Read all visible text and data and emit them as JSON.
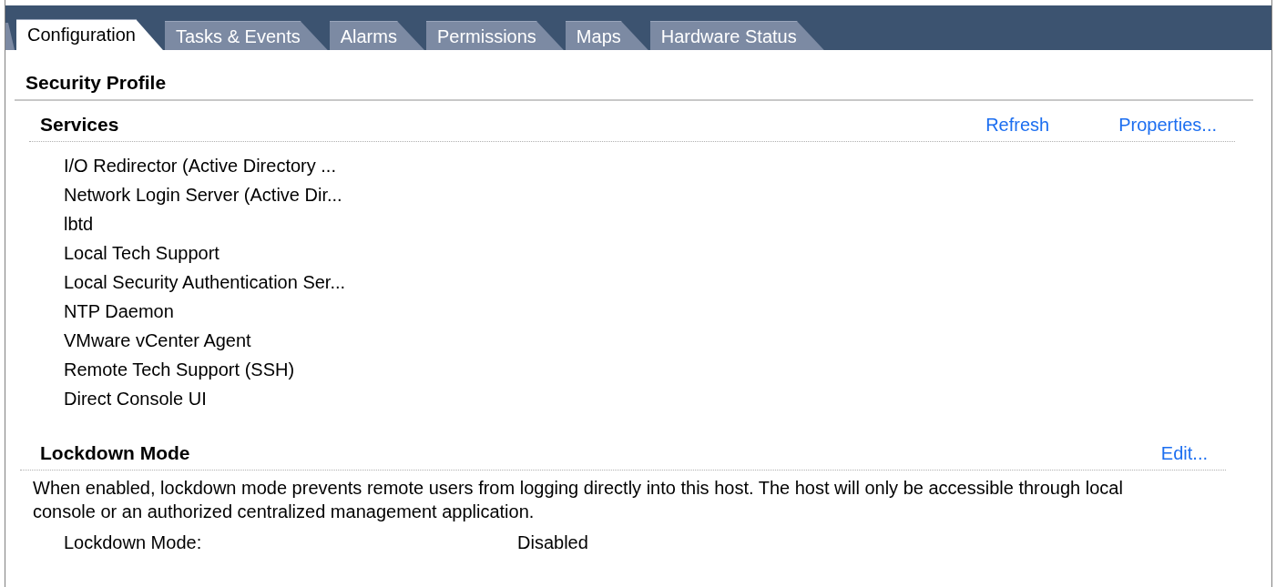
{
  "tabs": [
    {
      "label": "Configuration",
      "selected": true
    },
    {
      "label": "Tasks & Events",
      "selected": false
    },
    {
      "label": "Alarms",
      "selected": false
    },
    {
      "label": "Permissions",
      "selected": false
    },
    {
      "label": "Maps",
      "selected": false
    },
    {
      "label": "Hardware Status",
      "selected": false
    }
  ],
  "title": "Security Profile",
  "services": {
    "heading": "Services",
    "actions": [
      "Refresh",
      "Properties..."
    ],
    "items": [
      "I/O Redirector (Active Directory ...",
      "Network Login Server (Active Dir...",
      "lbtd",
      "Local Tech Support",
      "Local Security Authentication Ser...",
      "NTP Daemon",
      "VMware vCenter Agent",
      "Remote Tech Support (SSH)",
      "Direct Console UI"
    ]
  },
  "lockdown": {
    "heading": "Lockdown Mode",
    "actions": [
      "Edit..."
    ],
    "description": "When enabled, lockdown mode prevents remote users from logging directly into this host. The host will only be accessible through local console or an authorized centralized management application.",
    "fields": [
      {
        "label": "Lockdown Mode:",
        "value": "Disabled"
      }
    ]
  }
}
